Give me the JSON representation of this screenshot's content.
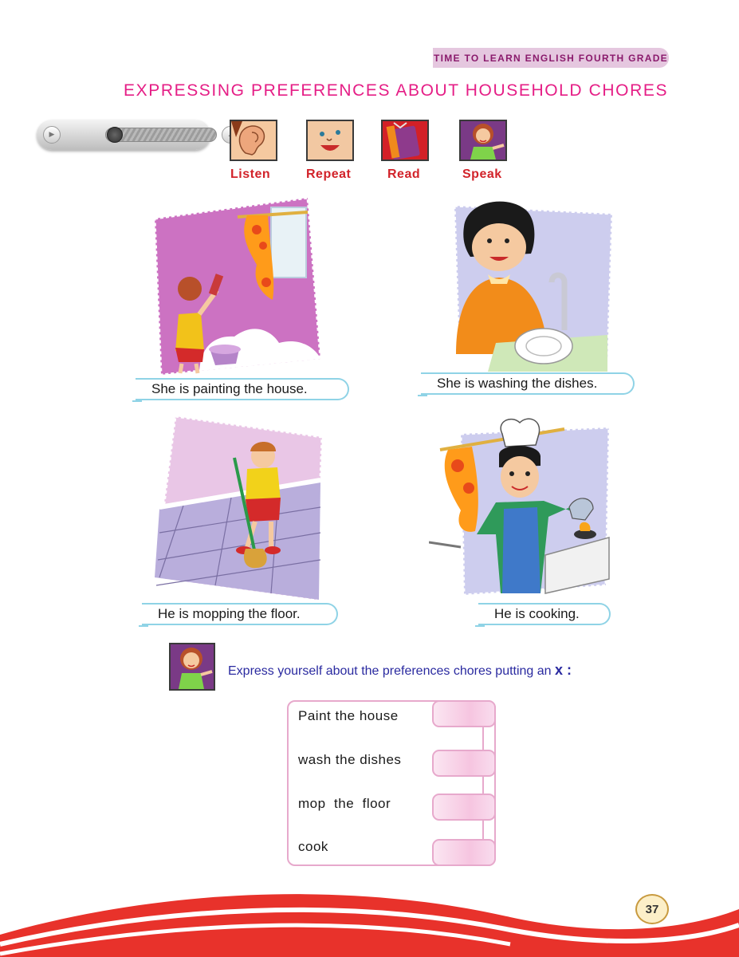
{
  "header": {
    "banner": "TIME TO LEARN ENGLISH FOURTH GRADE"
  },
  "title": "EXPRESSING PREFERENCES ABOUT HOUSEHOLD CHORES",
  "audio_player": {
    "play_icon": "play-icon",
    "volume_icon": "volume-icon"
  },
  "skills": [
    {
      "label": "Listen",
      "icon": "ear-icon"
    },
    {
      "label": "Repeat",
      "icon": "face-icon"
    },
    {
      "label": "Read",
      "icon": "book-icon"
    },
    {
      "label": "Speak",
      "icon": "speaking-girl-icon"
    }
  ],
  "scenes": [
    {
      "caption": "She is painting the house."
    },
    {
      "caption": "She is washing the dishes."
    },
    {
      "caption": "He is mopping the floor."
    },
    {
      "caption": "He is cooking."
    }
  ],
  "exercise": {
    "instruction": "Express yourself about the preferences chores putting an",
    "mark": "x :",
    "chores": [
      "Paint the house",
      "wash the dishes",
      "mop  the  floor",
      "cook"
    ]
  },
  "footer": {
    "page_number": "37"
  },
  "colors": {
    "title": "#e51e86",
    "skill_label": "#d2232a",
    "instruction": "#2a2aa0",
    "caption_border": "#8fd3e6",
    "box_border": "#e7a9cc"
  }
}
